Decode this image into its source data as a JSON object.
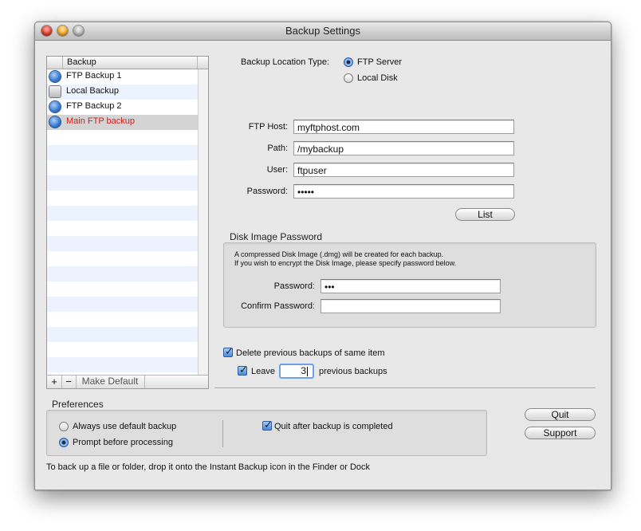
{
  "window": {
    "title": "Backup Settings"
  },
  "list": {
    "header": "Backup",
    "items": [
      {
        "label": "FTP Backup 1",
        "icon": "globe-icon",
        "selected": false
      },
      {
        "label": "Local Backup",
        "icon": "hard-disk-icon",
        "selected": false
      },
      {
        "label": "FTP Backup 2",
        "icon": "globe-icon",
        "selected": false
      },
      {
        "label": "Main FTP backup",
        "icon": "globe-icon",
        "selected": true
      }
    ],
    "add_label": "+",
    "remove_label": "−",
    "make_default_label": "Make Default"
  },
  "location": {
    "label": "Backup Location Type:",
    "options": [
      {
        "label": "FTP Server",
        "selected": true
      },
      {
        "label": "Local Disk",
        "selected": false
      }
    ]
  },
  "ftp": {
    "host_label": "FTP Host:",
    "host_value": "myftphost.com",
    "path_label": "Path:",
    "path_value": "/mybackup",
    "user_label": "User:",
    "user_value": "ftpuser",
    "password_label": "Password:",
    "password_value": "•••••",
    "list_button": "List"
  },
  "disk_image": {
    "title": "Disk Image Password",
    "desc_line1": "A compressed Disk Image (.dmg) will be created for each backup.",
    "desc_line2": "If you wish to encrypt the Disk Image, please specify password below.",
    "password_label": "Password:",
    "password_value": "•••",
    "confirm_label": "Confirm Password:",
    "confirm_value": ""
  },
  "delete_previous": {
    "label": "Delete previous backups of same item",
    "checked": true,
    "leave_label": "Leave",
    "leave_checked": true,
    "leave_value": "3",
    "leave_suffix": "previous backups"
  },
  "preferences": {
    "title": "Preferences",
    "always_default": "Always use default backup",
    "prompt_before": "Prompt before processing",
    "selected": "prompt_before",
    "quit_after": "Quit after backup is completed",
    "quit_after_checked": true
  },
  "buttons": {
    "quit": "Quit",
    "support": "Support"
  },
  "footer_hint": "To back up a file or folder, drop it onto the Instant Backup icon in the Finder or Dock"
}
